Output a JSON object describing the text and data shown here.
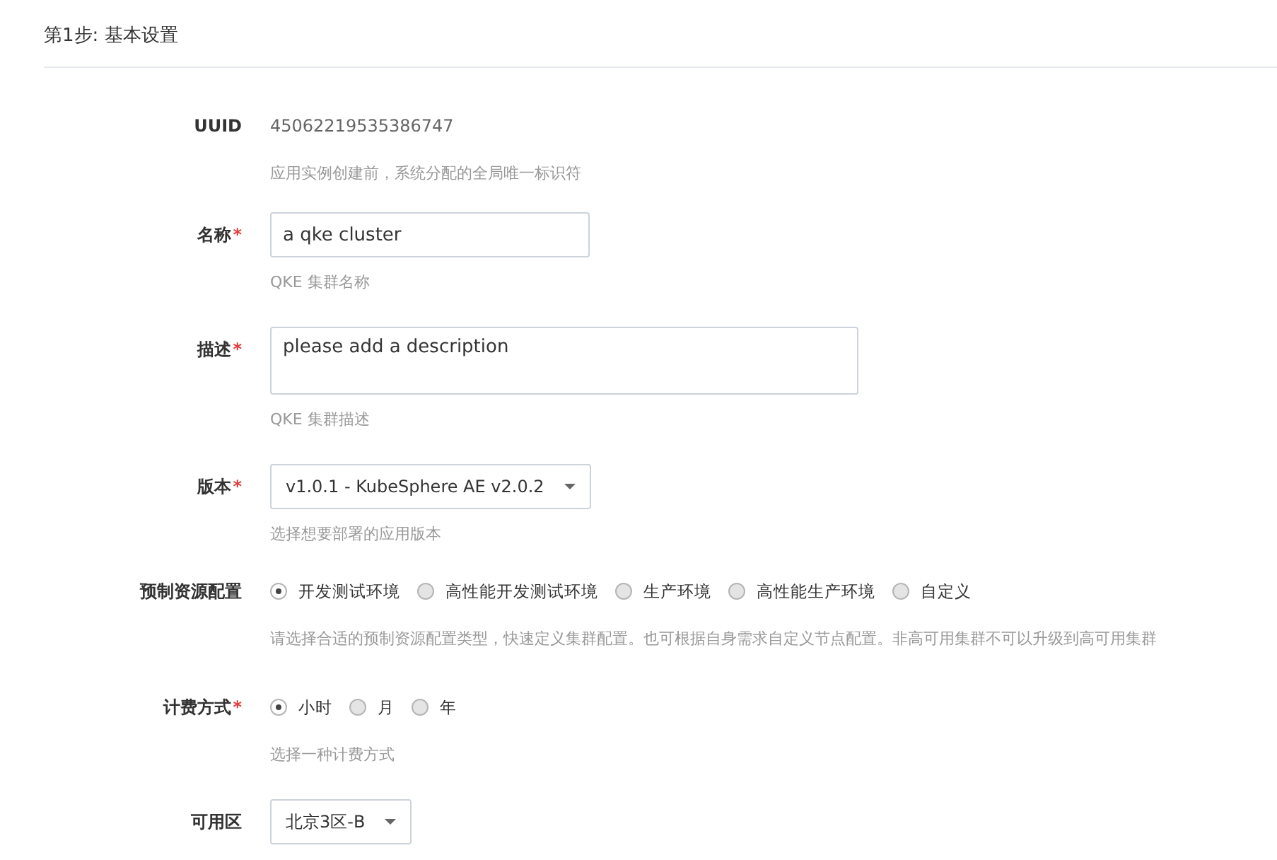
{
  "section": {
    "title": "第1步: 基本设置"
  },
  "fields": [
    {
      "kind": "text",
      "label": "UUID",
      "value": "45062219535386747",
      "hint": "应用实例创建前，系统分配的全局唯一标识符"
    },
    {
      "kind": "input",
      "label": "名称",
      "mark": "*",
      "value": "a qke cluster",
      "hint": "QKE 集群名称"
    },
    {
      "kind": "textarea",
      "label": "描述",
      "mark": "*",
      "placeholder": "please add a description",
      "hint": "QKE 集群描述"
    },
    {
      "kind": "select",
      "label": "版本",
      "mark": "*",
      "value": "v1.0.1 - KubeSphere AE v2.0.2",
      "hint": "选择想要部署的应用版本"
    },
    {
      "kind": "radio",
      "label": "预制资源配置",
      "options": [
        {
          "label": "开发测试环境",
          "selected": true
        },
        {
          "label": "高性能开发测试环境",
          "selected": false
        },
        {
          "label": "生产环境",
          "selected": false
        },
        {
          "label": "高性能生产环境",
          "selected": false
        },
        {
          "label": "自定义",
          "selected": false
        }
      ],
      "hint": "请选择合适的预制资源配置类型，快速定义集群配置。也可根据自身需求自定义节点配置。非高可用集群不可以升级到高可用集群"
    },
    {
      "kind": "radio",
      "label": "计费方式",
      "mark": "*",
      "options": [
        {
          "label": "小时",
          "selected": true
        },
        {
          "label": "月",
          "selected": false
        },
        {
          "label": "年",
          "selected": false
        }
      ],
      "hint": "选择一种计费方式"
    },
    {
      "kind": "select",
      "label": "可用区",
      "value": "北京3区-B"
    }
  ]
}
